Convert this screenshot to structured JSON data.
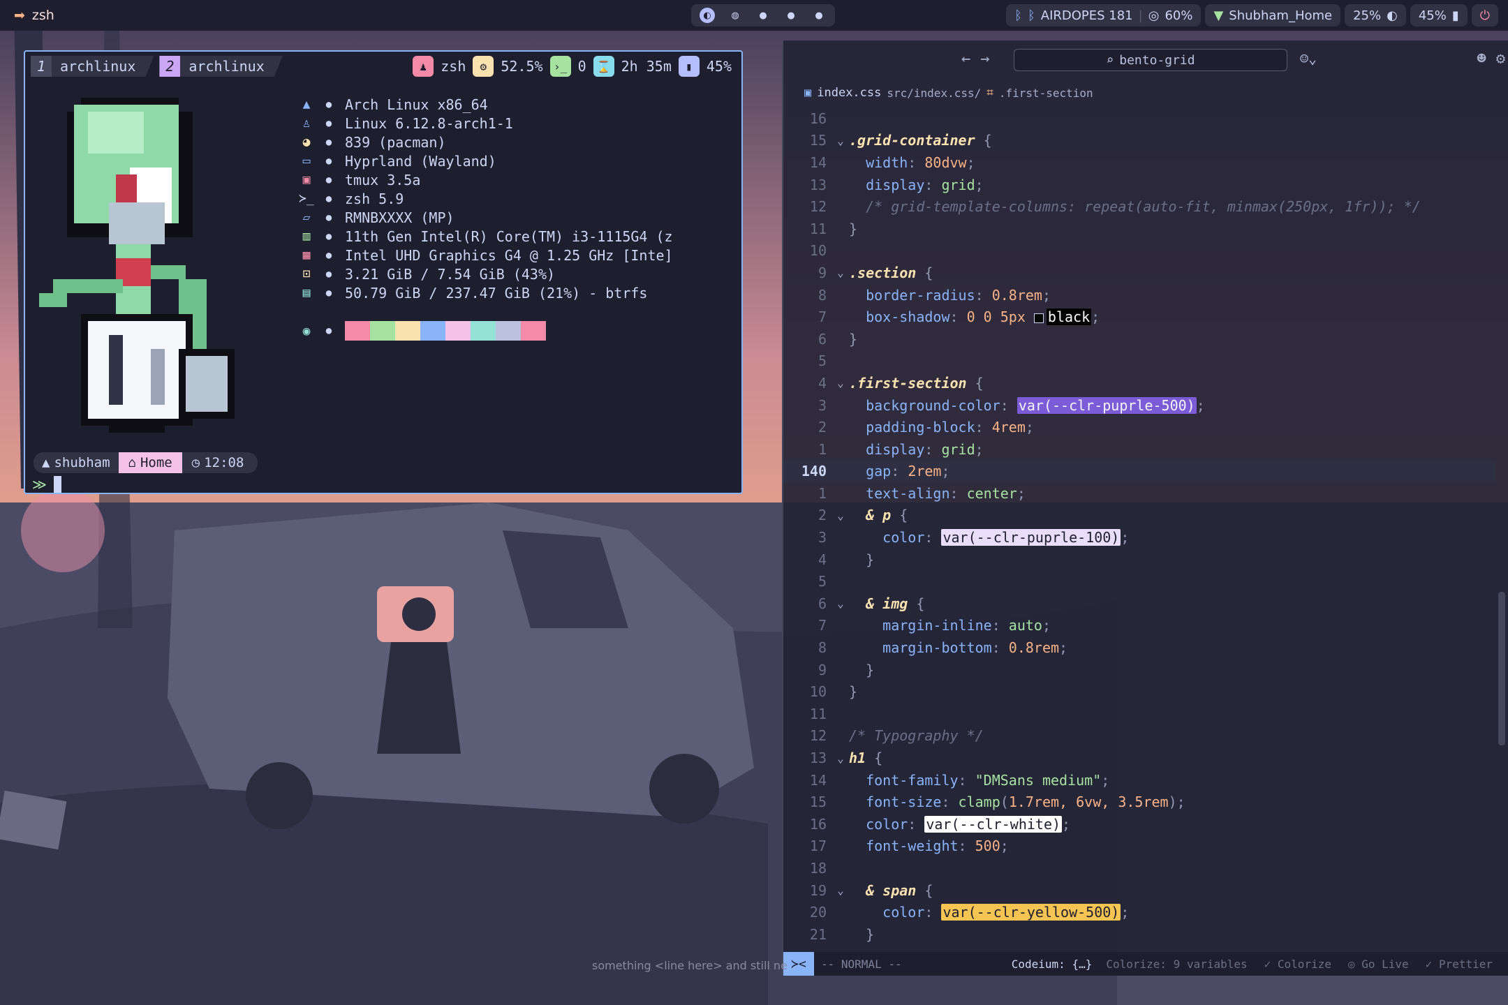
{
  "topbar": {
    "left_icon": "arrow-right-icon",
    "left_text": "zsh",
    "workspaces": [
      "1",
      "2",
      "3",
      "4",
      "5"
    ],
    "bluetooth_device": "AIRDOPES 181",
    "volume": "60%",
    "wifi": "Shubham_Home",
    "brightness": "25%",
    "battery": "45%"
  },
  "terminal": {
    "windows": [
      {
        "num": "1",
        "name": "archlinux"
      },
      {
        "num": "2",
        "name": "archlinux"
      }
    ],
    "stats": {
      "shell": "zsh",
      "cpu": "52.5%",
      "term": "0",
      "uptime": "2h 35m",
      "battery": "45%"
    },
    "sysinfo": [
      {
        "icon": "arch-icon",
        "text": "Arch Linux x86_64"
      },
      {
        "icon": "linux-icon",
        "text": "Linux 6.12.8-arch1-1"
      },
      {
        "icon": "package-icon",
        "text": "839 (pacman)"
      },
      {
        "icon": "monitor-icon",
        "text": "Hyprland (Wayland)"
      },
      {
        "icon": "terminal-icon",
        "text": "tmux 3.5a"
      },
      {
        "icon": "shell-icon",
        "text": "zsh 5.9"
      },
      {
        "icon": "laptop-icon",
        "text": "RMNBXXXX (MP)"
      },
      {
        "icon": "cpu-icon",
        "text": "11th Gen Intel(R) Core(TM) i3-1115G4 (z"
      },
      {
        "icon": "gpu-icon",
        "text": "Intel UHD Graphics G4 @ 1.25 GHz [Inte]"
      },
      {
        "icon": "memory-icon",
        "text": "3.21 GiB / 7.54 GiB (43%)"
      },
      {
        "icon": "disk-icon",
        "text": "50.79 GiB / 237.47 GiB (21%) - btrfs"
      }
    ],
    "palette": [
      "#f38ba8",
      "#a6e3a1",
      "#f9e2af",
      "#89b4fa",
      "#f5c2e7",
      "#94e2d5",
      "#bac2de",
      "#f38ba8"
    ],
    "prompt": {
      "user": "shubham",
      "dir": "Home",
      "time": "12:08"
    }
  },
  "editor": {
    "search": "bento-grid",
    "file": "index.css",
    "path": "src/index.css/",
    "symbol": ".first-section",
    "lines": [
      {
        "n": "16",
        "tokens": []
      },
      {
        "n": "15",
        "fold": true,
        "tokens": [
          {
            "c": "sel",
            "t": ".grid-container"
          },
          {
            "c": "punc",
            "t": " {"
          }
        ]
      },
      {
        "n": "14",
        "tokens": [
          {
            "c": "prop",
            "t": "  width"
          },
          {
            "c": "punc",
            "t": ": "
          },
          {
            "c": "val",
            "t": "80dvw"
          },
          {
            "c": "punc",
            "t": ";"
          }
        ]
      },
      {
        "n": "13",
        "tokens": [
          {
            "c": "prop",
            "t": "  display"
          },
          {
            "c": "punc",
            "t": ": "
          },
          {
            "c": "kw",
            "t": "grid"
          },
          {
            "c": "punc",
            "t": ";"
          }
        ]
      },
      {
        "n": "12",
        "tokens": [
          {
            "c": "cmt",
            "t": "  /* grid-template-columns: repeat(auto-fit, minmax(250px, 1fr)); */"
          }
        ]
      },
      {
        "n": "11",
        "tokens": [
          {
            "c": "punc",
            "t": "}"
          }
        ]
      },
      {
        "n": "10",
        "tokens": []
      },
      {
        "n": "9",
        "fold": true,
        "tokens": [
          {
            "c": "sel",
            "t": ".section"
          },
          {
            "c": "punc",
            "t": " {"
          }
        ]
      },
      {
        "n": "8",
        "tokens": [
          {
            "c": "prop",
            "t": "  border-radius"
          },
          {
            "c": "punc",
            "t": ": "
          },
          {
            "c": "val",
            "t": "0.8rem"
          },
          {
            "c": "punc",
            "t": ";"
          }
        ]
      },
      {
        "n": "7",
        "tokens": [
          {
            "c": "prop",
            "t": "  box-shadow"
          },
          {
            "c": "punc",
            "t": ": "
          },
          {
            "c": "val",
            "t": "0 0 5px "
          },
          {
            "c": "swatch",
            "t": ""
          },
          {
            "c": "chip-black",
            "t": "black"
          },
          {
            "c": "punc",
            "t": ";"
          }
        ]
      },
      {
        "n": "6",
        "tokens": [
          {
            "c": "punc",
            "t": "}"
          }
        ]
      },
      {
        "n": "5",
        "tokens": []
      },
      {
        "n": "4",
        "fold": true,
        "tokens": [
          {
            "c": "sel",
            "t": ".first-section"
          },
          {
            "c": "punc",
            "t": " {"
          }
        ]
      },
      {
        "n": "3",
        "tokens": [
          {
            "c": "prop",
            "t": "  background-color"
          },
          {
            "c": "punc",
            "t": ": "
          },
          {
            "c": "chip-purple",
            "t": "var(--clr-puprle-500)"
          },
          {
            "c": "punc",
            "t": ";"
          }
        ]
      },
      {
        "n": "2",
        "tokens": [
          {
            "c": "prop",
            "t": "  padding-block"
          },
          {
            "c": "punc",
            "t": ": "
          },
          {
            "c": "val",
            "t": "4rem"
          },
          {
            "c": "punc",
            "t": ";"
          }
        ]
      },
      {
        "n": "1",
        "tokens": [
          {
            "c": "prop",
            "t": "  display"
          },
          {
            "c": "punc",
            "t": ": "
          },
          {
            "c": "kw",
            "t": "grid"
          },
          {
            "c": "punc",
            "t": ";"
          }
        ]
      },
      {
        "n": "140",
        "current": true,
        "tokens": [
          {
            "c": "prop",
            "t": "  gap"
          },
          {
            "c": "punc",
            "t": ": "
          },
          {
            "c": "val",
            "t": "2rem"
          },
          {
            "c": "punc",
            "t": ";"
          }
        ]
      },
      {
        "n": "1",
        "tokens": [
          {
            "c": "prop",
            "t": "  text-align"
          },
          {
            "c": "punc",
            "t": ": "
          },
          {
            "c": "kw",
            "t": "center"
          },
          {
            "c": "punc",
            "t": ";"
          }
        ]
      },
      {
        "n": "2",
        "fold": true,
        "tokens": [
          {
            "c": "sel",
            "t": "  & p"
          },
          {
            "c": "punc",
            "t": " {"
          }
        ]
      },
      {
        "n": "3",
        "tokens": [
          {
            "c": "prop",
            "t": "    color"
          },
          {
            "c": "punc",
            "t": ": "
          },
          {
            "c": "chip-lilac",
            "t": "var(--clr-puprle-100)"
          },
          {
            "c": "punc",
            "t": ";"
          }
        ]
      },
      {
        "n": "4",
        "tokens": [
          {
            "c": "punc",
            "t": "  }"
          }
        ]
      },
      {
        "n": "5",
        "tokens": []
      },
      {
        "n": "6",
        "fold": true,
        "tokens": [
          {
            "c": "sel",
            "t": "  & img"
          },
          {
            "c": "punc",
            "t": " {"
          }
        ]
      },
      {
        "n": "7",
        "tokens": [
          {
            "c": "prop",
            "t": "    margin-inline"
          },
          {
            "c": "punc",
            "t": ": "
          },
          {
            "c": "kw",
            "t": "auto"
          },
          {
            "c": "punc",
            "t": ";"
          }
        ]
      },
      {
        "n": "8",
        "tokens": [
          {
            "c": "prop",
            "t": "    margin-bottom"
          },
          {
            "c": "punc",
            "t": ": "
          },
          {
            "c": "val",
            "t": "0.8rem"
          },
          {
            "c": "punc",
            "t": ";"
          }
        ]
      },
      {
        "n": "9",
        "tokens": [
          {
            "c": "punc",
            "t": "  }"
          }
        ]
      },
      {
        "n": "10",
        "tokens": [
          {
            "c": "punc",
            "t": "}"
          }
        ]
      },
      {
        "n": "11",
        "tokens": []
      },
      {
        "n": "12",
        "tokens": [
          {
            "c": "cmt",
            "t": "/* Typography */"
          }
        ]
      },
      {
        "n": "13",
        "fold": true,
        "tokens": [
          {
            "c": "sel",
            "t": "h1"
          },
          {
            "c": "punc",
            "t": " {"
          }
        ]
      },
      {
        "n": "14",
        "tokens": [
          {
            "c": "prop",
            "t": "  font-family"
          },
          {
            "c": "punc",
            "t": ": "
          },
          {
            "c": "str",
            "t": "\"DMSans medium\""
          },
          {
            "c": "punc",
            "t": ";"
          }
        ]
      },
      {
        "n": "15",
        "tokens": [
          {
            "c": "prop",
            "t": "  font-size"
          },
          {
            "c": "punc",
            "t": ": "
          },
          {
            "c": "kw",
            "t": "clamp"
          },
          {
            "c": "punc",
            "t": "("
          },
          {
            "c": "val",
            "t": "1.7rem, 6vw, 3.5rem"
          },
          {
            "c": "punc",
            "t": ");"
          }
        ]
      },
      {
        "n": "16",
        "tokens": [
          {
            "c": "prop",
            "t": "  color"
          },
          {
            "c": "punc",
            "t": ": "
          },
          {
            "c": "chip-white",
            "t": "var(--clr-white)"
          },
          {
            "c": "punc",
            "t": ";"
          }
        ]
      },
      {
        "n": "17",
        "tokens": [
          {
            "c": "prop",
            "t": "  font-weight"
          },
          {
            "c": "punc",
            "t": ": "
          },
          {
            "c": "val",
            "t": "500"
          },
          {
            "c": "punc",
            "t": ";"
          }
        ]
      },
      {
        "n": "18",
        "tokens": []
      },
      {
        "n": "19",
        "fold": true,
        "tokens": [
          {
            "c": "sel",
            "t": "  & span"
          },
          {
            "c": "punc",
            "t": " {"
          }
        ]
      },
      {
        "n": "20",
        "tokens": [
          {
            "c": "prop",
            "t": "    color"
          },
          {
            "c": "punc",
            "t": ": "
          },
          {
            "c": "chip-yellow",
            "t": "var(--clr-yellow-500)"
          },
          {
            "c": "punc",
            "t": ";"
          }
        ]
      },
      {
        "n": "21",
        "tokens": [
          {
            "c": "punc",
            "t": "  }"
          }
        ]
      }
    ],
    "status": {
      "mode": "-- NORMAL --",
      "codeium": "Codeium: {…}",
      "colorize_vars": "Colorize: 9 variables",
      "colorize": "Colorize",
      "golive": "Go Live",
      "prettier": "Prettier"
    }
  },
  "desktop_text": "something <line here> and still ne"
}
